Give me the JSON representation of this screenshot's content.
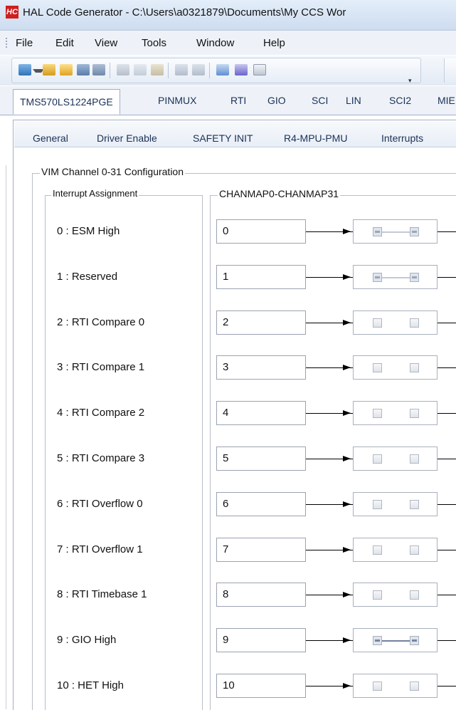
{
  "window": {
    "icon_text": "HC",
    "title": "HAL Code Generator - C:\\Users\\a0321879\\Documents\\My CCS Wor"
  },
  "menu": [
    "File",
    "Edit",
    "View",
    "Tools",
    "Window",
    "Help"
  ],
  "toolbar": {
    "icons": [
      "new-icon",
      "dropdown-arrow-icon",
      "open-project-icon",
      "open-folder-icon",
      "save-icon",
      "save-all-icon",
      "cut-icon",
      "copy-icon",
      "paste-icon",
      "undo-icon",
      "redo-icon",
      "generate-code-icon",
      "build-icon",
      "properties-icon"
    ],
    "overflow_glyph": "▾"
  },
  "device_tabs": [
    "TMS570LS1224PGE",
    "PINMUX",
    "RTI",
    "GIO",
    "SCI",
    "LIN",
    "SCI2",
    "MIE"
  ],
  "active_device_tab": "TMS570LS1224PGE",
  "sub_tabs": [
    "General",
    "Driver Enable",
    "SAFETY INIT",
    "R4-MPU-PMU",
    "Interrupts"
  ],
  "vim_group": {
    "title": "VIM Channel 0-31 Configuration",
    "interrupt_group_title": "Interrupt Assignment",
    "chanmap_group_title": "CHANMAP0-CHANMAP31",
    "rows": [
      {
        "label": "0 : ESM High",
        "channel": "0",
        "enable": true,
        "fiq": true,
        "locked": true
      },
      {
        "label": "1 : Reserved",
        "channel": "1",
        "enable": true,
        "fiq": true,
        "locked": true
      },
      {
        "label": "2 : RTI Compare 0",
        "channel": "2",
        "enable": false,
        "fiq": false,
        "locked": false
      },
      {
        "label": "3 : RTI Compare 1",
        "channel": "3",
        "enable": false,
        "fiq": false,
        "locked": false
      },
      {
        "label": "4 : RTI Compare 2",
        "channel": "4",
        "enable": false,
        "fiq": false,
        "locked": false
      },
      {
        "label": "5 : RTI Compare 3",
        "channel": "5",
        "enable": false,
        "fiq": false,
        "locked": false
      },
      {
        "label": "6 : RTI Overflow 0",
        "channel": "6",
        "enable": false,
        "fiq": false,
        "locked": false
      },
      {
        "label": "7 : RTI Overflow 1",
        "channel": "7",
        "enable": false,
        "fiq": false,
        "locked": false
      },
      {
        "label": "8 : RTI Timebase 1",
        "channel": "8",
        "enable": false,
        "fiq": false,
        "locked": false
      },
      {
        "label": "9 : GIO High",
        "channel": "9",
        "enable": true,
        "fiq": true,
        "locked": false
      },
      {
        "label": "10 : HET High",
        "channel": "10",
        "enable": false,
        "fiq": false,
        "locked": false
      }
    ]
  }
}
